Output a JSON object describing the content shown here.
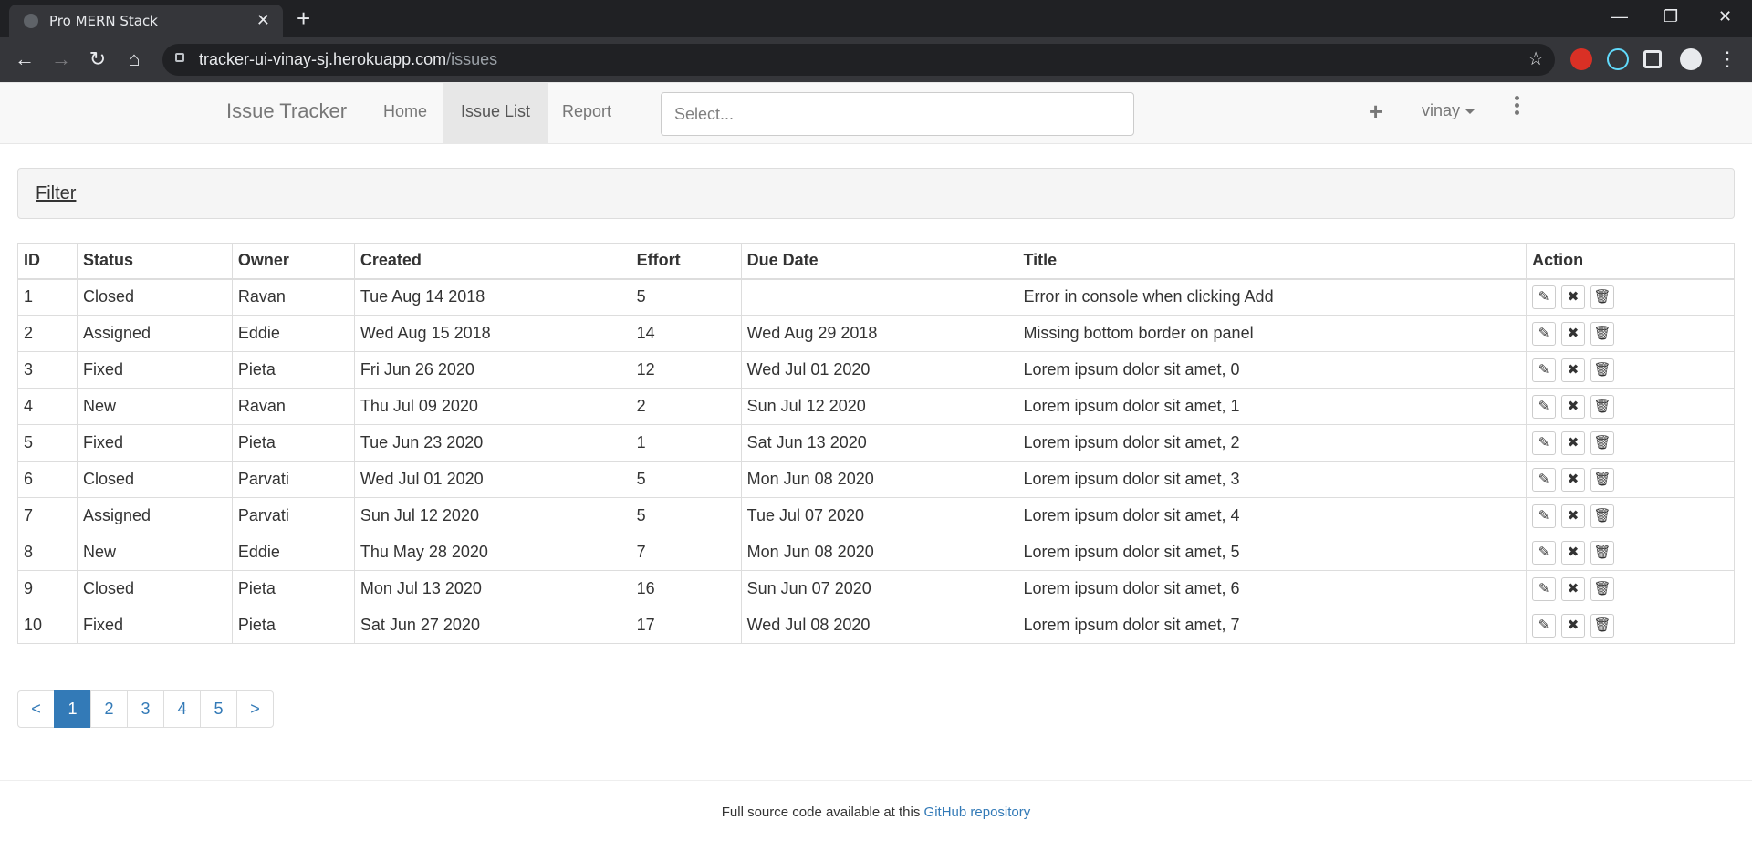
{
  "browser": {
    "tab_title": "Pro MERN Stack",
    "tab_close": "✕",
    "new_tab": "+",
    "url_host": "tracker-ui-vinay-sj.herokuapp.com",
    "url_path": "/issues",
    "window_controls": [
      "—",
      "❐",
      "✕"
    ],
    "nav_icons": [
      "back-icon",
      "forward-icon",
      "reload-icon",
      "home-icon"
    ],
    "extension_icons": [
      "ublock-icon",
      "react-devtools-icon",
      "extensions-icon",
      "profile-icon"
    ],
    "accent": "#202124"
  },
  "navbar": {
    "brand": "Issue Tracker",
    "links": [
      {
        "label": "Home",
        "active": false
      },
      {
        "label": "Issue List",
        "active": true
      },
      {
        "label": "Report",
        "active": false
      }
    ],
    "search_placeholder": "Select...",
    "add_icon": "+",
    "user": "vinay"
  },
  "filter": {
    "title": "Filter"
  },
  "table": {
    "headers": [
      "ID",
      "Status",
      "Owner",
      "Created",
      "Effort",
      "Due Date",
      "Title",
      "Action"
    ],
    "rows": [
      [
        "1",
        "Closed",
        "Ravan",
        "Tue Aug 14 2018",
        "5",
        "",
        "Error in console when clicking Add"
      ],
      [
        "2",
        "Assigned",
        "Eddie",
        "Wed Aug 15 2018",
        "14",
        "Wed Aug 29 2018",
        "Missing bottom border on panel"
      ],
      [
        "3",
        "Fixed",
        "Pieta",
        "Fri Jun 26 2020",
        "12",
        "Wed Jul 01 2020",
        "Lorem ipsum dolor sit amet, 0"
      ],
      [
        "4",
        "New",
        "Ravan",
        "Thu Jul 09 2020",
        "2",
        "Sun Jul 12 2020",
        "Lorem ipsum dolor sit amet, 1"
      ],
      [
        "5",
        "Fixed",
        "Pieta",
        "Tue Jun 23 2020",
        "1",
        "Sat Jun 13 2020",
        "Lorem ipsum dolor sit amet, 2"
      ],
      [
        "6",
        "Closed",
        "Parvati",
        "Wed Jul 01 2020",
        "5",
        "Mon Jun 08 2020",
        "Lorem ipsum dolor sit amet, 3"
      ],
      [
        "7",
        "Assigned",
        "Parvati",
        "Sun Jul 12 2020",
        "5",
        "Tue Jul 07 2020",
        "Lorem ipsum dolor sit amet, 4"
      ],
      [
        "8",
        "New",
        "Eddie",
        "Thu May 28 2020",
        "7",
        "Mon Jun 08 2020",
        "Lorem ipsum dolor sit amet, 5"
      ],
      [
        "9",
        "Closed",
        "Pieta",
        "Mon Jul 13 2020",
        "16",
        "Sun Jun 07 2020",
        "Lorem ipsum dolor sit amet, 6"
      ],
      [
        "10",
        "Fixed",
        "Pieta",
        "Sat Jun 27 2020",
        "17",
        "Wed Jul 08 2020",
        "Lorem ipsum dolor sit amet, 7"
      ]
    ],
    "action_icons": [
      {
        "name": "edit-icon",
        "glyph": "✎"
      },
      {
        "name": "close-issue-icon",
        "glyph": "✖"
      },
      {
        "name": "delete-icon",
        "glyph": "🗑"
      }
    ]
  },
  "pagination": {
    "prev": "<",
    "pages": [
      "1",
      "2",
      "3",
      "4",
      "5"
    ],
    "current": "1",
    "next": ">",
    "accent": "#337ab7"
  },
  "footer": {
    "text": "Full source code available at this ",
    "link": "GitHub repository"
  }
}
